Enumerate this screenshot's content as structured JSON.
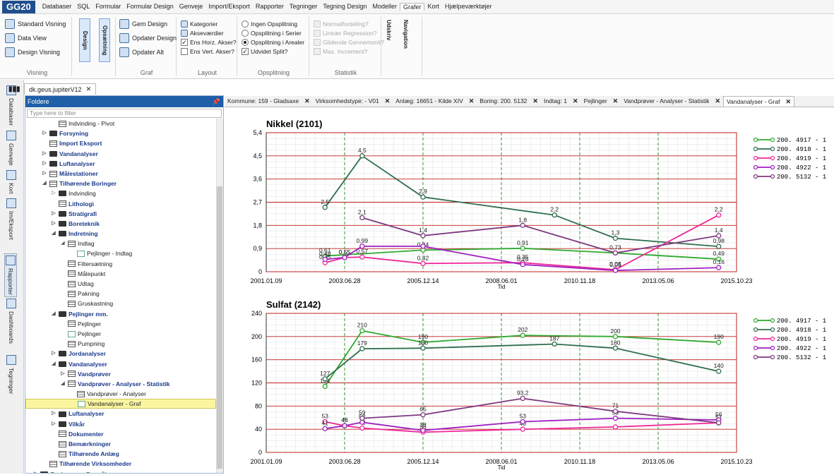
{
  "app": {
    "logo": "GG20"
  },
  "menu": [
    "Databaser",
    "SQL",
    "Formular",
    "Formular Design",
    "Genveje",
    "Import/Eksport",
    "Rapporter",
    "Tegninger",
    "Tegning Design",
    "Modeller",
    "Grafer",
    "Kort",
    "Hjælpeværktøjer"
  ],
  "menu_active": "Grafer",
  "ribbon": {
    "visning": {
      "name": "Visning",
      "buttons": [
        "Standard Visning",
        "Data View",
        "Design Visning"
      ]
    },
    "design_btn": "Design",
    "opsaetning_btn": "Opsætning",
    "graf": {
      "name": "Graf",
      "buttons": [
        "Gem Design",
        "Opdater Design",
        "Opdater Alt"
      ]
    },
    "layout": {
      "name": "Layout",
      "items": [
        {
          "label": "Kategorier",
          "type": "icon"
        },
        {
          "label": "Akseværdier",
          "type": "icon"
        },
        {
          "label": "Ens Horz. Akser?",
          "type": "check",
          "checked": true
        },
        {
          "label": "Ens Vert. Akser?",
          "type": "check",
          "checked": false
        }
      ]
    },
    "opsplitning": {
      "name": "Opsplitning",
      "items": [
        {
          "label": "Ingen Opsplitning",
          "type": "radio",
          "checked": false
        },
        {
          "label": "Opsplitning i Serier",
          "type": "radio",
          "checked": false
        },
        {
          "label": "Opsplitning i Arealer",
          "type": "radio",
          "checked": true
        },
        {
          "label": "Udvidet Split?",
          "type": "check",
          "checked": true
        }
      ]
    },
    "statistik": {
      "name": "Statistik",
      "items": [
        "Normalfordeling?",
        "Lineær Regression?",
        "Glidende Gennemsnit?",
        "Max. Increment?"
      ]
    },
    "udskriv": "Udskriv",
    "navigation": "Navigation"
  },
  "leftbar": [
    {
      "label": "Databaser"
    },
    {
      "label": "Genveje"
    },
    {
      "label": "Kort"
    },
    {
      "label": "Im/Eksport"
    },
    {
      "label": "Rapporter",
      "selected": true
    },
    {
      "label": "Dashboards"
    },
    {
      "label": "Tegninger"
    }
  ],
  "doc_tab": "dk.geus.jupiterV12",
  "tree": {
    "header": "Foldere",
    "filter_placeholder": "Type here to filter",
    "nodes": [
      {
        "label": "Indvinding - Pivot",
        "indent": 4,
        "icon": "pivot"
      },
      {
        "label": "Forsyning",
        "indent": 3,
        "icon": "folder",
        "arrow": "closed",
        "bold": true
      },
      {
        "label": "Import Eksport",
        "indent": 3,
        "icon": "table",
        "bold": true
      },
      {
        "label": "Vandanalyser",
        "indent": 3,
        "icon": "folder",
        "arrow": "closed",
        "bold": true
      },
      {
        "label": "Luftanalyser",
        "indent": 3,
        "icon": "folder",
        "arrow": "closed",
        "bold": true
      },
      {
        "label": "Målestationer",
        "indent": 3,
        "icon": "table",
        "arrow": "closed",
        "bold": true
      },
      {
        "label": "Tilhørende Boringer",
        "indent": 3,
        "icon": "table",
        "arrow": "open",
        "bold": true
      },
      {
        "label": "Indvinding",
        "indent": 4,
        "icon": "folder",
        "arrow": "closed"
      },
      {
        "label": "Lithologi",
        "indent": 4,
        "icon": "table",
        "bold": true
      },
      {
        "label": "Stratigrafi",
        "indent": 4,
        "icon": "folder",
        "arrow": "closed",
        "bold": true
      },
      {
        "label": "Boreteknik",
        "indent": 4,
        "icon": "folder",
        "arrow": "closed",
        "bold": true
      },
      {
        "label": "Indretning",
        "indent": 4,
        "icon": "folder",
        "arrow": "open",
        "bold": true
      },
      {
        "label": "Indtag",
        "indent": 5,
        "icon": "table",
        "arrow": "open"
      },
      {
        "label": "Pejlinger - Indtag",
        "indent": 6,
        "icon": "graph"
      },
      {
        "label": "Filtersætning",
        "indent": 5,
        "icon": "table"
      },
      {
        "label": "Målepunkt",
        "indent": 5,
        "icon": "table"
      },
      {
        "label": "Udtag",
        "indent": 5,
        "icon": "table"
      },
      {
        "label": "Pakning",
        "indent": 5,
        "icon": "table"
      },
      {
        "label": "Gruskastning",
        "indent": 5,
        "icon": "table"
      },
      {
        "label": "Pejlinger mm.",
        "indent": 4,
        "icon": "folder",
        "arrow": "open",
        "bold": true
      },
      {
        "label": "Pejlinger",
        "indent": 5,
        "icon": "table"
      },
      {
        "label": "Pejlinger",
        "indent": 5,
        "icon": "graph"
      },
      {
        "label": "Pumpning",
        "indent": 5,
        "icon": "table"
      },
      {
        "label": "Jordanalyser",
        "indent": 4,
        "icon": "folder",
        "arrow": "closed",
        "bold": true
      },
      {
        "label": "Vandanalyser",
        "indent": 4,
        "icon": "folder",
        "arrow": "open",
        "bold": true
      },
      {
        "label": "Vandprøver",
        "indent": 5,
        "icon": "table",
        "arrow": "closed",
        "bold": true
      },
      {
        "label": "Vandprøver - Analyser - Statistik",
        "indent": 5,
        "icon": "pivot",
        "arrow": "open",
        "bold": true
      },
      {
        "label": "Vandprøver - Analyser",
        "indent": 6,
        "icon": "table"
      },
      {
        "label": "Vandanalyser - Graf",
        "indent": 6,
        "icon": "graph",
        "selected": true
      },
      {
        "label": "Luftanalyser",
        "indent": 4,
        "icon": "folder",
        "arrow": "closed",
        "bold": true
      },
      {
        "label": "Vilkår",
        "indent": 4,
        "icon": "folder",
        "arrow": "closed",
        "bold": true
      },
      {
        "label": "Dokumenter",
        "indent": 4,
        "icon": "table",
        "bold": true
      },
      {
        "label": "Bemærkninger",
        "indent": 4,
        "icon": "table",
        "bold": true
      },
      {
        "label": "Tilhørende Anlæg",
        "indent": 4,
        "icon": "table",
        "bold": true
      },
      {
        "label": "Tilhørende Virksomheder",
        "indent": 3,
        "icon": "table",
        "bold": true
      },
      {
        "label": "Boringer pr. Formål",
        "indent": 2,
        "icon": "folder",
        "arrow": "closed",
        "green": true
      }
    ]
  },
  "tabs": [
    "Kommune: 159 - Gladsaxe",
    "Virksomhedstype: - V01",
    "Anlæg: 16651 - Kilde XIV",
    "Boring: 200. 5132",
    "Indtag: 1",
    "Pejlinger",
    "Vandprøver - Analyser - Statistik",
    "Vandanalyser - Graf"
  ],
  "tab_active": 7,
  "colors": {
    "s4917": "#2eaa2e",
    "s4918": "#2e6e4e",
    "s4919": "#f02898",
    "s4922": "#a020c0",
    "s5132": "#7e3a80"
  },
  "chart_data": [
    {
      "type": "line",
      "title": "Nikkel (2101)",
      "xlabel": "Tid",
      "ylabel": "",
      "xticks": [
        "2001.01.09",
        "2003.06.28",
        "2005.12.14",
        "2008.06.01",
        "2010.11.18",
        "2013.05.06",
        "2015.10.23"
      ],
      "yticks": [
        "0",
        "0,9",
        "1,8",
        "2,7",
        "3,6",
        "4,5",
        "5,4"
      ],
      "ylim": [
        0,
        5.4
      ],
      "series": [
        {
          "name": "200. 4917 - 1",
          "color": "#2eaa2e",
          "points": [
            [
              "2002.11.15",
              0.61,
              "0,61"
            ],
            [
              "2005.12.14",
              0.84,
              "0,84"
            ],
            [
              "2009.02.01",
              0.91,
              "0,91"
            ],
            [
              "2012.01.01",
              0.73,
              "0,73"
            ],
            [
              "2015.04.01",
              0.49,
              "0,49"
            ]
          ]
        },
        {
          "name": "200. 4918 - 1",
          "color": "#2e6e4e",
          "points": [
            [
              "2002.11.15",
              2.5,
              "2,5"
            ],
            [
              "2004.01.15",
              4.5,
              "4,5"
            ],
            [
              "2005.12.14",
              2.9,
              "2,9"
            ],
            [
              "2010.02.01",
              2.2,
              "2,2"
            ],
            [
              "2012.01.01",
              1.3,
              "1,3"
            ],
            [
              "2015.04.01",
              0.98,
              "0,98"
            ]
          ]
        },
        {
          "name": "200. 4919 - 1",
          "color": "#f02898",
          "points": [
            [
              "2002.11.15",
              0.35,
              "0,35"
            ],
            [
              "2003.06.28",
              0.55,
              "0,55"
            ],
            [
              "2004.01.15",
              0.57,
              "0,57"
            ],
            [
              "2005.12.14",
              0.32,
              "0,32"
            ],
            [
              "2009.02.01",
              0.35,
              "0,35"
            ],
            [
              "2012.01.01",
              0.08,
              "0,08"
            ],
            [
              "2015.04.01",
              2.2,
              "2,2"
            ]
          ]
        },
        {
          "name": "200. 4922 - 1",
          "color": "#a020c0",
          "points": [
            [
              "2002.11.15",
              0.48,
              "0,48"
            ],
            [
              "2003.06.28",
              0.55,
              "0,55"
            ],
            [
              "2004.01.15",
              0.99,
              "0,99"
            ],
            [
              "2005.12.14",
              0.99,
              ""
            ],
            [
              "2009.02.01",
              0.28,
              "0,28"
            ],
            [
              "2012.01.01",
              0.05,
              "0,05"
            ],
            [
              "2015.04.01",
              0.16,
              "0,16"
            ]
          ]
        },
        {
          "name": "200. 5132 - 1",
          "color": "#7e3a80",
          "points": [
            [
              "2004.01.15",
              2.1,
              "2,1"
            ],
            [
              "2005.12.14",
              1.4,
              "1,4"
            ],
            [
              "2009.02.01",
              1.8,
              "1,8"
            ],
            [
              "2012.01.01",
              0.73,
              ""
            ],
            [
              "2015.04.01",
              1.4,
              "1,4"
            ]
          ]
        }
      ]
    },
    {
      "type": "line",
      "title": "Sulfat (2142)",
      "xlabel": "Tid",
      "ylabel": "",
      "xticks": [
        "2001.01.09",
        "2003.06.28",
        "2005.12.14",
        "2008.06.01",
        "2010.11.18",
        "2013.05.06",
        "2015.10.23"
      ],
      "yticks": [
        "0",
        "40",
        "80",
        "120",
        "160",
        "200",
        "240"
      ],
      "ylim": [
        0,
        240
      ],
      "series": [
        {
          "name": "200. 4917 - 1",
          "color": "#2eaa2e",
          "points": [
            [
              "2002.11.15",
              114,
              "104"
            ],
            [
              "2004.01.15",
              210,
              "210"
            ],
            [
              "2005.12.14",
              190,
              "190"
            ],
            [
              "2009.02.01",
              202,
              "202"
            ],
            [
              "2012.01.01",
              200,
              "200"
            ],
            [
              "2015.04.01",
              190,
              "190"
            ]
          ]
        },
        {
          "name": "200. 4918 - 1",
          "color": "#2e6e4e",
          "points": [
            [
              "2002.11.15",
              127,
              "127"
            ],
            [
              "2004.01.15",
              179,
              "179"
            ],
            [
              "2005.12.14",
              180,
              "180"
            ],
            [
              "2010.02.01",
              187,
              "187"
            ],
            [
              "2012.01.01",
              180,
              "180"
            ],
            [
              "2015.04.01",
              140,
              "140"
            ]
          ]
        },
        {
          "name": "200. 4919 - 1",
          "color": "#f02898",
          "points": [
            [
              "2002.11.15",
              53,
              "53"
            ],
            [
              "2003.06.28",
              46,
              "46"
            ],
            [
              "2004.01.15",
              42,
              "42"
            ],
            [
              "2005.12.14",
              35,
              "35"
            ],
            [
              "2009.02.01",
              40,
              "40"
            ],
            [
              "2012.01.01",
              44,
              ""
            ],
            [
              "2015.04.01",
              51,
              "51"
            ]
          ]
        },
        {
          "name": "200. 4922 - 1",
          "color": "#a020c0",
          "points": [
            [
              "2002.11.15",
              41,
              "41"
            ],
            [
              "2003.06.28",
              46,
              "46"
            ],
            [
              "2004.01.15",
              52,
              "52"
            ],
            [
              "2005.12.14",
              38,
              "38"
            ],
            [
              "2009.02.01",
              53,
              "53"
            ],
            [
              "2012.01.01",
              59,
              "59"
            ],
            [
              "2015.04.01",
              56,
              "56"
            ]
          ]
        },
        {
          "name": "200. 5132 - 1",
          "color": "#7e3a80",
          "points": [
            [
              "2004.01.15",
              59,
              "59"
            ],
            [
              "2005.12.14",
              65,
              "65"
            ],
            [
              "2009.02.01",
              93.2,
              "93,2"
            ],
            [
              "2012.01.01",
              71,
              "71"
            ],
            [
              "2015.04.01",
              51,
              ""
            ]
          ]
        }
      ]
    }
  ]
}
